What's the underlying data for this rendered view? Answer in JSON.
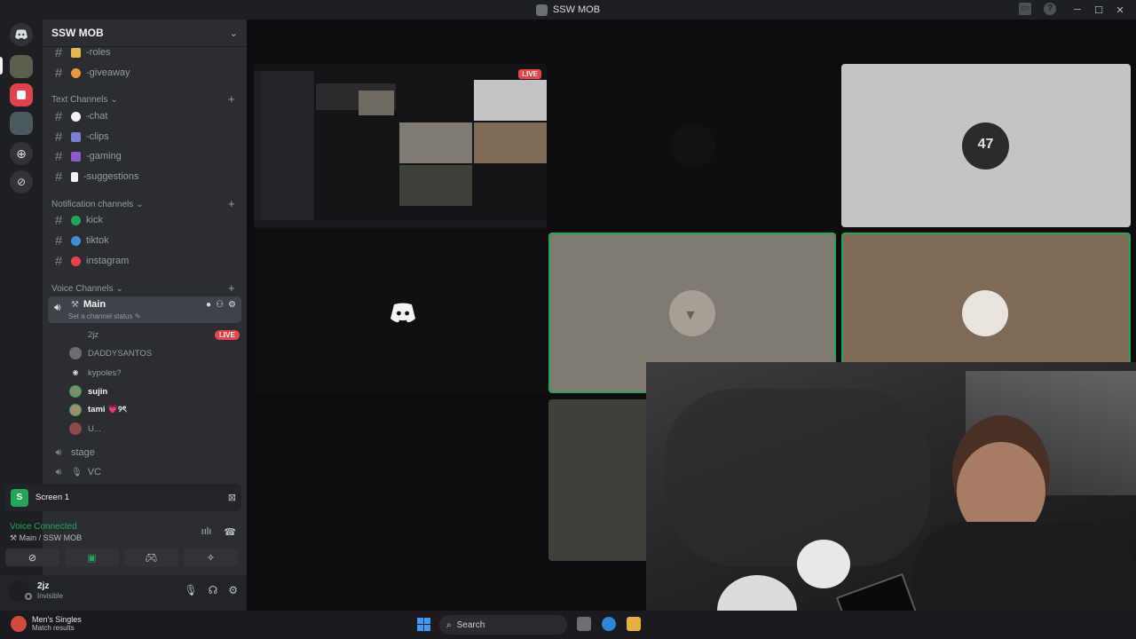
{
  "window": {
    "title": "SSW MOB"
  },
  "server": {
    "name": "SSW MOB"
  },
  "channels_top": [
    {
      "name": "-roles",
      "emoji_color": "#e8b64a"
    },
    {
      "name": "-giveaway",
      "emoji_color": "#e89a3a"
    }
  ],
  "text_category": "Text Channels",
  "text_channels": [
    {
      "name": "-chat",
      "emoji_color": "#f2f3f5"
    },
    {
      "name": "-clips",
      "emoji_color": "#7b7fd6"
    },
    {
      "name": "-gaming",
      "emoji_color": "#8b5cc7"
    },
    {
      "name": "-suggestions",
      "emoji_color": "#f2f3f5"
    }
  ],
  "notification_category": "Notification channels",
  "notification_channels": [
    {
      "name": "kick",
      "dot_color": "#23a55a"
    },
    {
      "name": "tiktok",
      "dot_color": "#3b8fd9"
    },
    {
      "name": "instagram",
      "dot_color": "#ed4245"
    }
  ],
  "voice_category": "Voice Channels",
  "main_voice": {
    "name": "Main",
    "status_placeholder": "Set a channel status"
  },
  "voice_users": [
    {
      "name": "2jz",
      "live": "LIVE"
    },
    {
      "name": "DADDYSANTOS"
    },
    {
      "name": "kypoles?"
    },
    {
      "name": "sujin"
    },
    {
      "name": "tami 💗୨ৎ"
    },
    {
      "name": "U..."
    }
  ],
  "other_voice": [
    {
      "name": "stage"
    },
    {
      "name": "VC"
    }
  ],
  "screen_panel": {
    "label": "Screen 1"
  },
  "voice_status": {
    "connected": "Voice Connected",
    "channel": "Main / SSW MOB"
  },
  "user": {
    "name": "2jz",
    "status": "Invisible"
  },
  "stage": {
    "live_label": "LIVE"
  },
  "taskbar": {
    "weather_title": "Men's Singles",
    "weather_sub": "Match results",
    "search_label": "Search"
  },
  "colors": {
    "accent_green": "#23a55a",
    "live_red": "#ed4245",
    "tile_grey": "#c4c4c4",
    "tile_taupe": "#7f7b72",
    "tile_brown": "#7e6a57",
    "tile_olive": "#3e403a"
  }
}
